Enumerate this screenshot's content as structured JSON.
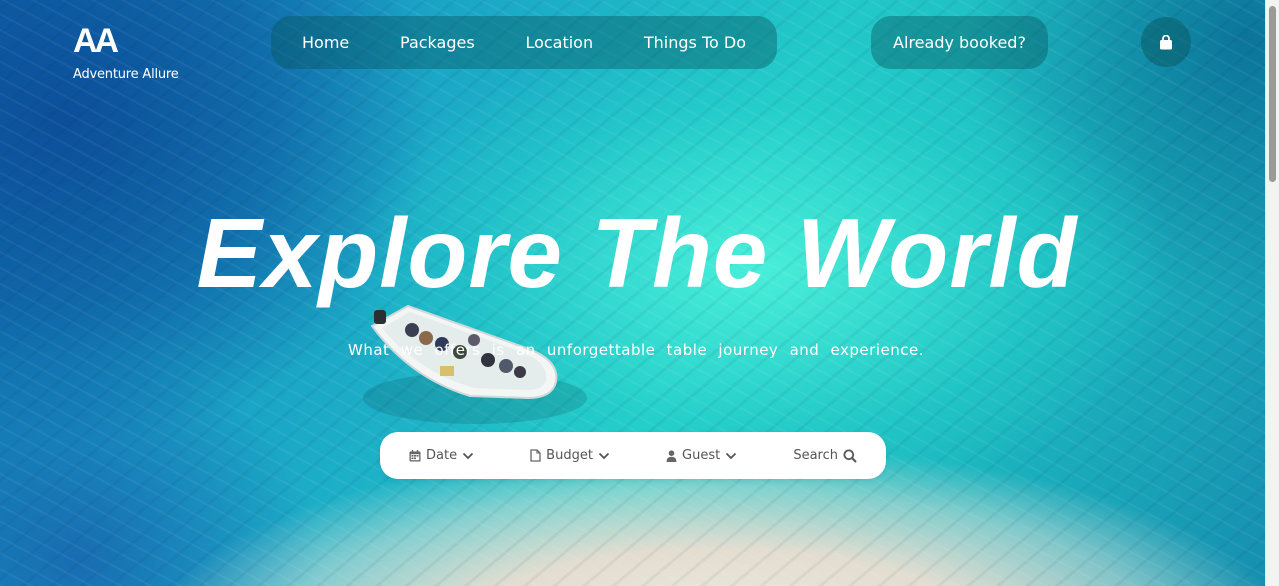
{
  "logo": {
    "mark": "AA",
    "name": "Adventure Allure"
  },
  "nav": {
    "items": [
      {
        "label": "Home"
      },
      {
        "label": "Packages"
      },
      {
        "label": "Location"
      },
      {
        "label": "Things To Do"
      }
    ]
  },
  "header": {
    "booked_label": "Already booked?",
    "cart_icon": "shopping-bag-icon"
  },
  "hero": {
    "title": "Explore The World",
    "subtitle": "What we offers is an unforgettable table journey and experience."
  },
  "search_bar": {
    "date": {
      "label": "Date",
      "icon": "calendar-icon"
    },
    "budget": {
      "label": "Budget",
      "icon": "document-icon"
    },
    "guest": {
      "label": "Guest",
      "icon": "user-icon"
    },
    "search": {
      "label": "Search",
      "icon": "search-icon"
    }
  },
  "colors": {
    "nav_background": "#08555f",
    "text_light": "#ffffff",
    "search_text": "#555555"
  }
}
